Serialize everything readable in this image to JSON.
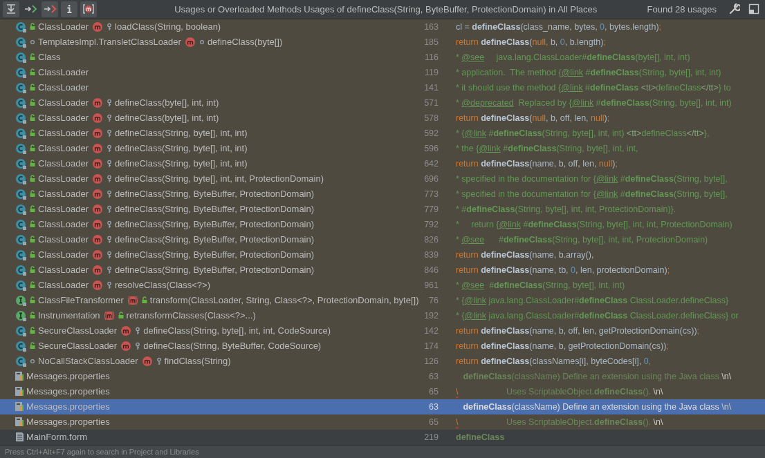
{
  "toolbar": {
    "buttons": [
      {
        "kind": "merge",
        "selected": true
      },
      {
        "kind": "read",
        "selected": false
      },
      {
        "kind": "write",
        "selected": true
      },
      {
        "kind": "info",
        "selected": true
      },
      {
        "kind": "method",
        "selected": true
      }
    ],
    "title": "Usages or Overloaded Methods Usages of defineClass(String, ByteBuffer, ProtectionDomain) in All Places",
    "count": "Found 28 usages"
  },
  "rows": [
    {
      "kind": "class",
      "icons": [
        {
          "kind": "class"
        },
        {
          "kind": "lock"
        }
      ],
      "owner": "ClassLoader",
      "method_icons": [
        {
          "kind": "method"
        },
        {
          "kind": "key"
        }
      ],
      "method": "loadClass(String, boolean)",
      "line": "163",
      "selected": false,
      "code": [
        {
          "kind": "plain",
          "text": "cl = "
        },
        {
          "kind": "call",
          "text": "defineClass"
        },
        {
          "kind": "plain",
          "text": "(class_name, bytes, "
        },
        {
          "kind": "number",
          "text": "0"
        },
        {
          "kind": "plain",
          "text": ", bytes.length)"
        },
        {
          "kind": "keyword",
          "text": ";"
        }
      ]
    },
    {
      "kind": "class",
      "icons": [
        {
          "kind": "class"
        },
        {
          "kind": "dot"
        }
      ],
      "owner": "TemplatesImpl.TransletClassLoader",
      "method_icons": [
        {
          "kind": "method"
        },
        {
          "kind": "dot"
        }
      ],
      "method": "defineClass(byte[])",
      "line": "185",
      "selected": false,
      "code": [
        {
          "kind": "keyword",
          "text": "return "
        },
        {
          "kind": "call",
          "text": "defineClass"
        },
        {
          "kind": "plain",
          "text": "("
        },
        {
          "kind": "keyword",
          "text": "null,"
        },
        {
          "kind": "plain",
          "text": " b, "
        },
        {
          "kind": "number",
          "text": "0"
        },
        {
          "kind": "plain",
          "text": ", b.length)"
        },
        {
          "kind": "keyword",
          "text": ";"
        }
      ]
    },
    {
      "kind": "class",
      "icons": [
        {
          "kind": "class"
        },
        {
          "kind": "lock"
        }
      ],
      "owner": "Class",
      "line": "116",
      "selected": false,
      "code": [
        {
          "kind": "comment",
          "text": "* "
        },
        {
          "kind": "link",
          "text": "@see"
        },
        {
          "kind": "comment",
          "text": "     java.lang.ClassLoader#"
        },
        {
          "kind": "comment-bold",
          "text": "defineClass"
        },
        {
          "kind": "comment",
          "text": "(byte[], int, int)"
        }
      ]
    },
    {
      "kind": "class",
      "icons": [
        {
          "kind": "class"
        },
        {
          "kind": "lock"
        }
      ],
      "owner": "ClassLoader",
      "line": "119",
      "selected": false,
      "code": [
        {
          "kind": "comment",
          "text": "* application.  The method {"
        },
        {
          "kind": "link",
          "text": "@link"
        },
        {
          "kind": "comment",
          "text": " #"
        },
        {
          "kind": "comment-bold",
          "text": "defineClass"
        },
        {
          "kind": "comment",
          "text": "(String, byte[], int, int)"
        }
      ]
    },
    {
      "kind": "class",
      "icons": [
        {
          "kind": "class"
        },
        {
          "kind": "lock"
        }
      ],
      "owner": "ClassLoader",
      "line": "141",
      "selected": false,
      "code": [
        {
          "kind": "comment",
          "text": "* it should use the method {"
        },
        {
          "kind": "link",
          "text": "@link"
        },
        {
          "kind": "comment",
          "text": " #"
        },
        {
          "kind": "comment-bold",
          "text": "defineClass"
        },
        {
          "kind": "tag",
          "text": " <tt>"
        },
        {
          "kind": "comment",
          "text": "defineClass"
        },
        {
          "kind": "tag",
          "text": "</tt>"
        },
        {
          "kind": "comment",
          "text": "} to"
        }
      ]
    },
    {
      "kind": "class",
      "icons": [
        {
          "kind": "class"
        },
        {
          "kind": "lock"
        }
      ],
      "owner": "ClassLoader",
      "method_icons": [
        {
          "kind": "method"
        },
        {
          "kind": "key"
        }
      ],
      "method": "defineClass(byte[], int, int)",
      "line": "571",
      "selected": false,
      "code": [
        {
          "kind": "comment",
          "text": "* "
        },
        {
          "kind": "link",
          "text": "@deprecated"
        },
        {
          "kind": "comment",
          "text": "  Replaced by {"
        },
        {
          "kind": "link",
          "text": "@link"
        },
        {
          "kind": "comment",
          "text": " #"
        },
        {
          "kind": "comment-bold",
          "text": "defineClass"
        },
        {
          "kind": "comment",
          "text": "(String, byte[], int, int)"
        }
      ]
    },
    {
      "kind": "class",
      "icons": [
        {
          "kind": "class"
        },
        {
          "kind": "lock"
        }
      ],
      "owner": "ClassLoader",
      "method_icons": [
        {
          "kind": "method"
        },
        {
          "kind": "key"
        }
      ],
      "method": "defineClass(byte[], int, int)",
      "line": "578",
      "selected": false,
      "code": [
        {
          "kind": "keyword",
          "text": "return "
        },
        {
          "kind": "call",
          "text": "defineClass"
        },
        {
          "kind": "plain",
          "text": "("
        },
        {
          "kind": "keyword",
          "text": "null"
        },
        {
          "kind": "plain",
          "text": ", b, off, len, "
        },
        {
          "kind": "keyword",
          "text": "null"
        },
        {
          "kind": "plain",
          "text": ")"
        },
        {
          "kind": "keyword",
          "text": ";"
        }
      ]
    },
    {
      "kind": "class",
      "icons": [
        {
          "kind": "class"
        },
        {
          "kind": "lock"
        }
      ],
      "owner": "ClassLoader",
      "method_icons": [
        {
          "kind": "method"
        },
        {
          "kind": "key"
        }
      ],
      "method": "defineClass(String, byte[], int, int)",
      "line": "592",
      "selected": false,
      "code": [
        {
          "kind": "comment",
          "text": "* {"
        },
        {
          "kind": "link",
          "text": "@link"
        },
        {
          "kind": "comment",
          "text": " #"
        },
        {
          "kind": "comment-bold",
          "text": "defineClass"
        },
        {
          "kind": "comment",
          "text": "(String, byte[], int, int) "
        },
        {
          "kind": "tag",
          "text": "<tt>"
        },
        {
          "kind": "comment",
          "text": "defineClass"
        },
        {
          "kind": "tag",
          "text": "</tt>"
        },
        {
          "kind": "comment",
          "text": "},"
        }
      ]
    },
    {
      "kind": "class",
      "icons": [
        {
          "kind": "class"
        },
        {
          "kind": "lock"
        }
      ],
      "owner": "ClassLoader",
      "method_icons": [
        {
          "kind": "method"
        },
        {
          "kind": "key"
        }
      ],
      "method": "defineClass(String, byte[], int, int)",
      "line": "596",
      "selected": false,
      "code": [
        {
          "kind": "comment",
          "text": "* the {"
        },
        {
          "kind": "link",
          "text": "@link"
        },
        {
          "kind": "comment",
          "text": " #"
        },
        {
          "kind": "comment-bold",
          "text": "defineClass"
        },
        {
          "kind": "comment",
          "text": "(String, byte[], int, int,"
        }
      ]
    },
    {
      "kind": "class",
      "icons": [
        {
          "kind": "class"
        },
        {
          "kind": "lock"
        }
      ],
      "owner": "ClassLoader",
      "method_icons": [
        {
          "kind": "method"
        },
        {
          "kind": "key"
        }
      ],
      "method": "defineClass(String, byte[], int, int)",
      "line": "642",
      "selected": false,
      "code": [
        {
          "kind": "keyword",
          "text": "return "
        },
        {
          "kind": "call",
          "text": "defineClass"
        },
        {
          "kind": "plain",
          "text": "(name, b, off, len, "
        },
        {
          "kind": "keyword",
          "text": "null"
        },
        {
          "kind": "plain",
          "text": ")"
        },
        {
          "kind": "keyword",
          "text": ";"
        }
      ]
    },
    {
      "kind": "class",
      "icons": [
        {
          "kind": "class"
        },
        {
          "kind": "lock"
        }
      ],
      "owner": "ClassLoader",
      "method_icons": [
        {
          "kind": "method"
        },
        {
          "kind": "key"
        }
      ],
      "method": "defineClass(String, byte[], int, int, ProtectionDomain)",
      "line": "696",
      "selected": false,
      "code": [
        {
          "kind": "comment",
          "text": "* specified in the documentation for {"
        },
        {
          "kind": "link",
          "text": "@link"
        },
        {
          "kind": "comment",
          "text": " #"
        },
        {
          "kind": "comment-bold",
          "text": "defineClass"
        },
        {
          "kind": "comment",
          "text": "(String, byte[],"
        }
      ]
    },
    {
      "kind": "class",
      "icons": [
        {
          "kind": "class"
        },
        {
          "kind": "lock"
        }
      ],
      "owner": "ClassLoader",
      "method_icons": [
        {
          "kind": "method"
        },
        {
          "kind": "key"
        }
      ],
      "method": "defineClass(String, ByteBuffer, ProtectionDomain)",
      "line": "773",
      "selected": false,
      "code": [
        {
          "kind": "comment",
          "text": "* specified in the documentation for {"
        },
        {
          "kind": "link",
          "text": "@link"
        },
        {
          "kind": "comment",
          "text": " #"
        },
        {
          "kind": "comment-bold",
          "text": "defineClass"
        },
        {
          "kind": "comment",
          "text": "(String, byte[],"
        }
      ]
    },
    {
      "kind": "class",
      "icons": [
        {
          "kind": "class"
        },
        {
          "kind": "lock"
        }
      ],
      "owner": "ClassLoader",
      "method_icons": [
        {
          "kind": "method"
        },
        {
          "kind": "key"
        }
      ],
      "method": "defineClass(String, ByteBuffer, ProtectionDomain)",
      "line": "779",
      "selected": false,
      "code": [
        {
          "kind": "comment",
          "text": "* #"
        },
        {
          "kind": "comment-bold",
          "text": "defineClass"
        },
        {
          "kind": "comment",
          "text": "(String, byte[], int, int, ProtectionDomain)}."
        }
      ]
    },
    {
      "kind": "class",
      "icons": [
        {
          "kind": "class"
        },
        {
          "kind": "lock"
        }
      ],
      "owner": "ClassLoader",
      "method_icons": [
        {
          "kind": "method"
        },
        {
          "kind": "key"
        }
      ],
      "method": "defineClass(String, ByteBuffer, ProtectionDomain)",
      "line": "792",
      "selected": false,
      "code": [
        {
          "kind": "comment",
          "text": "*     return {"
        },
        {
          "kind": "link",
          "text": "@link"
        },
        {
          "kind": "comment",
          "text": " #"
        },
        {
          "kind": "comment-bold",
          "text": "defineClass"
        },
        {
          "kind": "comment",
          "text": "(String, byte[], int, int, ProtectionDomain)"
        }
      ]
    },
    {
      "kind": "class",
      "icons": [
        {
          "kind": "class"
        },
        {
          "kind": "lock"
        }
      ],
      "owner": "ClassLoader",
      "method_icons": [
        {
          "kind": "method"
        },
        {
          "kind": "key"
        }
      ],
      "method": "defineClass(String, ByteBuffer, ProtectionDomain)",
      "line": "826",
      "selected": false,
      "code": [
        {
          "kind": "comment",
          "text": "* "
        },
        {
          "kind": "link",
          "text": "@see"
        },
        {
          "kind": "comment",
          "text": "      #"
        },
        {
          "kind": "comment-bold",
          "text": "defineClass"
        },
        {
          "kind": "comment",
          "text": "(String, byte[], int, int, ProtectionDomain)"
        }
      ]
    },
    {
      "kind": "class",
      "icons": [
        {
          "kind": "class"
        },
        {
          "kind": "lock"
        }
      ],
      "owner": "ClassLoader",
      "method_icons": [
        {
          "kind": "method"
        },
        {
          "kind": "key"
        }
      ],
      "method": "defineClass(String, ByteBuffer, ProtectionDomain)",
      "line": "839",
      "selected": false,
      "code": [
        {
          "kind": "keyword",
          "text": "return "
        },
        {
          "kind": "call",
          "text": "defineClass"
        },
        {
          "kind": "plain",
          "text": "(name, b.array(),"
        }
      ]
    },
    {
      "kind": "class",
      "icons": [
        {
          "kind": "class"
        },
        {
          "kind": "lock"
        }
      ],
      "owner": "ClassLoader",
      "method_icons": [
        {
          "kind": "method"
        },
        {
          "kind": "key"
        }
      ],
      "method": "defineClass(String, ByteBuffer, ProtectionDomain)",
      "line": "846",
      "selected": false,
      "code": [
        {
          "kind": "keyword",
          "text": "return "
        },
        {
          "kind": "call",
          "text": "defineClass"
        },
        {
          "kind": "plain",
          "text": "(name, tb, "
        },
        {
          "kind": "number",
          "text": "0"
        },
        {
          "kind": "plain",
          "text": ", len, protectionDomain)"
        },
        {
          "kind": "keyword",
          "text": ";"
        }
      ]
    },
    {
      "kind": "class",
      "icons": [
        {
          "kind": "class"
        },
        {
          "kind": "lock"
        }
      ],
      "owner": "ClassLoader",
      "method_icons": [
        {
          "kind": "method"
        },
        {
          "kind": "key"
        }
      ],
      "method": "resolveClass(Class<?>)",
      "line": "961",
      "selected": false,
      "code": [
        {
          "kind": "comment",
          "text": "* "
        },
        {
          "kind": "link",
          "text": "@see"
        },
        {
          "kind": "comment",
          "text": "  #"
        },
        {
          "kind": "comment-bold",
          "text": "defineClass"
        },
        {
          "kind": "comment",
          "text": "(String, byte[], int, int)"
        }
      ]
    },
    {
      "kind": "class",
      "icons": [
        {
          "kind": "interface"
        },
        {
          "kind": "lock"
        }
      ],
      "owner": "ClassFileTransformer",
      "method_icons": [
        {
          "kind": "abstract"
        },
        {
          "kind": "lock"
        }
      ],
      "method": "transform(ClassLoader, String, Class<?>, ProtectionDomain, byte[])",
      "line": "76",
      "selected": false,
      "code": [
        {
          "kind": "comment",
          "text": "* {"
        },
        {
          "kind": "link",
          "text": "@link"
        },
        {
          "kind": "comment",
          "text": " java.lang.ClassLoader#"
        },
        {
          "kind": "comment-bold",
          "text": "defineClass"
        },
        {
          "kind": "comment",
          "text": " ClassLoader.defineClass}"
        }
      ]
    },
    {
      "kind": "class",
      "icons": [
        {
          "kind": "interface"
        },
        {
          "kind": "lock"
        }
      ],
      "owner": "Instrumentation",
      "method_icons": [
        {
          "kind": "abstract"
        },
        {
          "kind": "lock"
        }
      ],
      "method": "retransformClasses(Class<?>...)",
      "line": "192",
      "selected": false,
      "code": [
        {
          "kind": "comment",
          "text": "* {"
        },
        {
          "kind": "link",
          "text": "@link"
        },
        {
          "kind": "comment",
          "text": " java.lang.ClassLoader#"
        },
        {
          "kind": "comment-bold",
          "text": "defineClass"
        },
        {
          "kind": "comment",
          "text": " ClassLoader.defineClass} or"
        }
      ]
    },
    {
      "kind": "class",
      "icons": [
        {
          "kind": "class"
        },
        {
          "kind": "lock"
        }
      ],
      "owner": "SecureClassLoader",
      "method_icons": [
        {
          "kind": "method"
        },
        {
          "kind": "key"
        }
      ],
      "method": "defineClass(String, byte[], int, int, CodeSource)",
      "line": "142",
      "selected": false,
      "code": [
        {
          "kind": "keyword",
          "text": "return "
        },
        {
          "kind": "call",
          "text": "defineClass"
        },
        {
          "kind": "plain",
          "text": "(name, b, off, len, getProtectionDomain(cs))"
        },
        {
          "kind": "keyword",
          "text": ";"
        }
      ]
    },
    {
      "kind": "class",
      "icons": [
        {
          "kind": "class"
        },
        {
          "kind": "lock"
        }
      ],
      "owner": "SecureClassLoader",
      "method_icons": [
        {
          "kind": "method"
        },
        {
          "kind": "key"
        }
      ],
      "method": "defineClass(String, ByteBuffer, CodeSource)",
      "line": "174",
      "selected": false,
      "code": [
        {
          "kind": "keyword",
          "text": "return "
        },
        {
          "kind": "call",
          "text": "defineClass"
        },
        {
          "kind": "plain",
          "text": "(name, b, getProtectionDomain(cs))"
        },
        {
          "kind": "keyword",
          "text": ";"
        }
      ]
    },
    {
      "kind": "class",
      "icons": [
        {
          "kind": "class"
        },
        {
          "kind": "dot"
        }
      ],
      "owner": "NoCallStackClassLoader",
      "method_icons": [
        {
          "kind": "method"
        },
        {
          "kind": "key"
        }
      ],
      "method": "findClass(String)",
      "line": "126",
      "selected": false,
      "code": [
        {
          "kind": "keyword",
          "text": "return "
        },
        {
          "kind": "call",
          "text": "defineClass"
        },
        {
          "kind": "plain",
          "text": "(classNames[i], byteCodes[i], "
        },
        {
          "kind": "number",
          "text": "0"
        },
        {
          "kind": "keyword",
          "text": ","
        }
      ]
    },
    {
      "kind": "properties",
      "owner": "Messages.properties",
      "line": "63",
      "selected": false,
      "code": [
        {
          "kind": "string-bold",
          "text": "   defineClass"
        },
        {
          "kind": "string",
          "text": "(className) Define an extension using the Java class "
        },
        {
          "kind": "escape",
          "text": "\\n\\"
        }
      ]
    },
    {
      "kind": "properties",
      "owner": "Messages.properties",
      "line": "65",
      "selected": false,
      "code": [
        {
          "kind": "error",
          "text": "\\"
        },
        {
          "kind": "string",
          "text": "                    Uses ScriptableObject."
        },
        {
          "kind": "string-bold",
          "text": "defineClass"
        },
        {
          "kind": "string",
          "text": "(). "
        },
        {
          "kind": "escape",
          "text": "\\n\\"
        }
      ]
    },
    {
      "kind": "properties",
      "owner": "Messages.properties",
      "line": "63",
      "selected": true,
      "code": [
        {
          "kind": "string-bold",
          "text": "   defineClass"
        },
        {
          "kind": "string",
          "text": "(className) Define an extension using the Java class "
        },
        {
          "kind": "escape",
          "text": "\\n\\"
        }
      ]
    },
    {
      "kind": "properties",
      "owner": "Messages.properties",
      "line": "65",
      "selected": false,
      "code": [
        {
          "kind": "error",
          "text": "\\"
        },
        {
          "kind": "string",
          "text": "                    Uses ScriptableObject."
        },
        {
          "kind": "string-bold",
          "text": "defineClass"
        },
        {
          "kind": "string",
          "text": "(). "
        },
        {
          "kind": "escape",
          "text": "\\n\\"
        }
      ]
    },
    {
      "kind": "form",
      "owner": "MainForm.form",
      "line": "219",
      "selected": false,
      "code": [
        {
          "kind": "string-bold",
          "text": "defineClass"
        }
      ]
    }
  ],
  "status_bar": "Press Ctrl+Alt+F7 again to search in Project and Libraries"
}
